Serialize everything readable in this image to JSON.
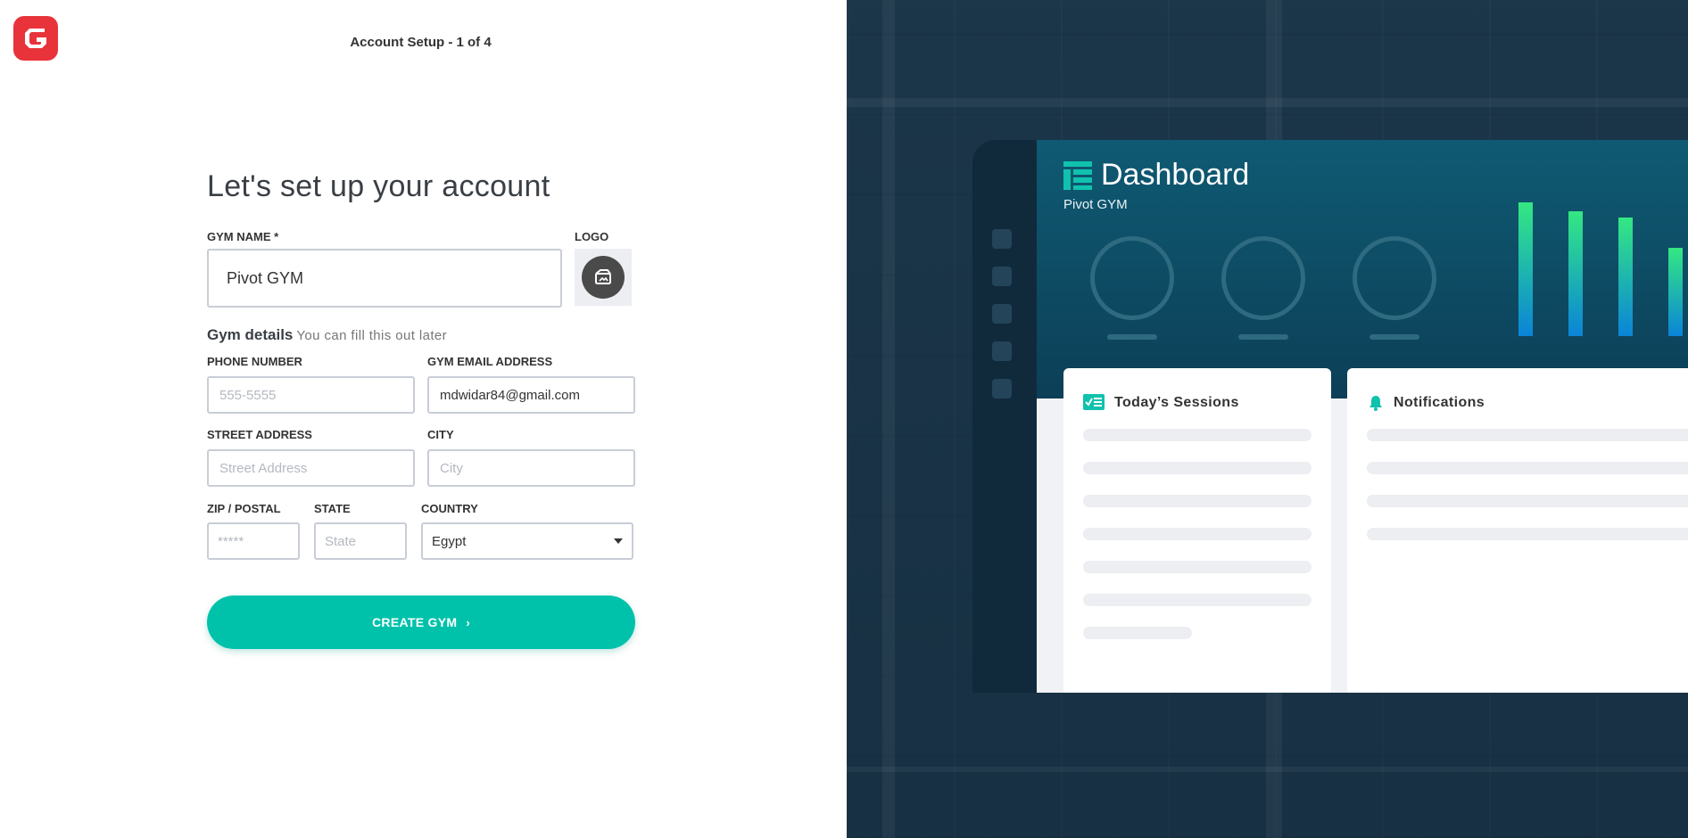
{
  "header": {
    "step_title": "Account Setup - 1 of 4"
  },
  "form": {
    "heading": "Let's set up your account",
    "gym_name": {
      "label": "GYM NAME *",
      "value": "Pivot GYM"
    },
    "logo": {
      "label": "LOGO"
    },
    "gym_details": {
      "title": "Gym details",
      "subtitle": "You can fill this out later"
    },
    "phone": {
      "label": "PHONE NUMBER",
      "placeholder": "555-5555"
    },
    "email": {
      "label": "GYM EMAIL ADDRESS",
      "value": "mdwidar84@gmail.com"
    },
    "street": {
      "label": "STREET ADDRESS",
      "placeholder": "Street Address"
    },
    "city": {
      "label": "CITY",
      "placeholder": "City"
    },
    "zip": {
      "label": "ZIP / POSTAL",
      "placeholder": "*****"
    },
    "state": {
      "label": "STATE",
      "placeholder": "State"
    },
    "country": {
      "label": "COUNTRY",
      "value": "Egypt"
    },
    "submit": {
      "label": "CREATE GYM",
      "chevron": "›"
    }
  },
  "preview": {
    "title": "Dashboard",
    "gym_name": "Pivot GYM",
    "cards": [
      {
        "title": "Today’s Sessions",
        "icon": "checklist-icon"
      },
      {
        "title": "Notifications",
        "icon": "bell-icon"
      }
    ]
  },
  "colors": {
    "brand_red": "#e8333b",
    "accent_teal": "#00c2ab",
    "panel_dark": "#1d3548"
  }
}
